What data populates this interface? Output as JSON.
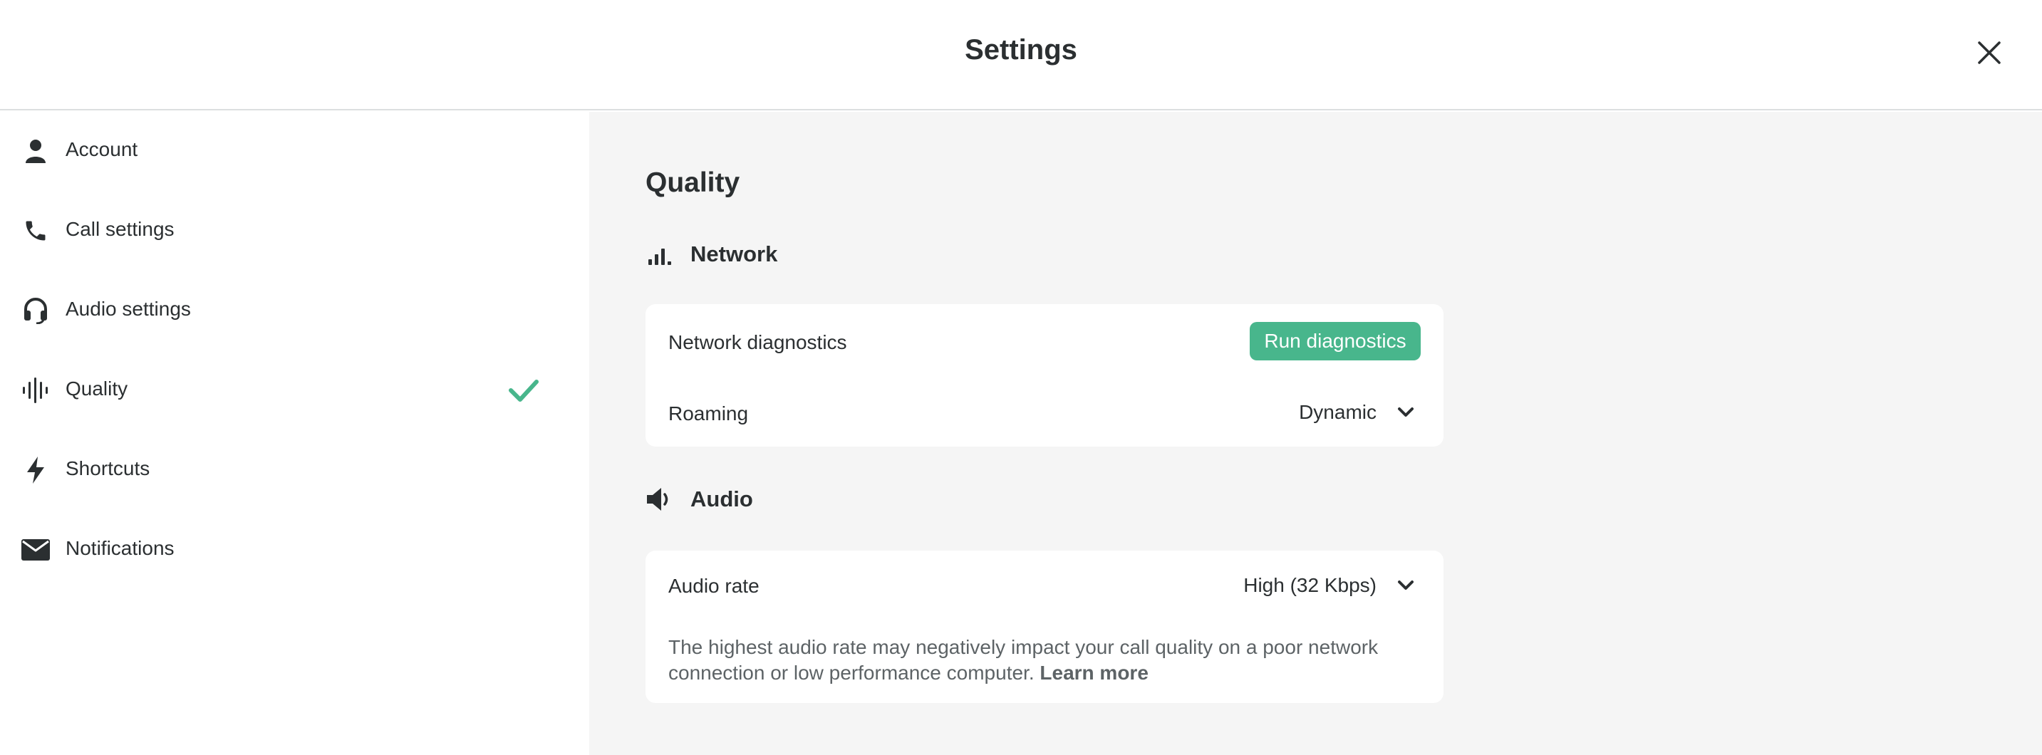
{
  "header": {
    "title": "Settings",
    "close_icon": "close-icon"
  },
  "sidebar": {
    "items": [
      {
        "label": "Account",
        "icon": "person-icon",
        "active": false
      },
      {
        "label": "Call settings",
        "icon": "phone-icon",
        "active": false
      },
      {
        "label": "Audio settings",
        "icon": "headset-icon",
        "active": false
      },
      {
        "label": "Quality",
        "icon": "waveform-icon",
        "active": true
      },
      {
        "label": "Shortcuts",
        "icon": "lightning-icon",
        "active": false
      },
      {
        "label": "Notifications",
        "icon": "envelope-icon",
        "active": false
      }
    ],
    "active_check_icon": "checkmark-icon"
  },
  "main": {
    "title": "Quality",
    "network": {
      "heading": "Network",
      "icon": "signal-bars-icon",
      "diagnostics_label": "Network diagnostics",
      "run_button": "Run diagnostics",
      "roaming_label": "Roaming",
      "roaming_value": "Dynamic"
    },
    "audio": {
      "heading": "Audio",
      "icon": "speaker-icon",
      "rate_label": "Audio rate",
      "rate_value": "High (32 Kbps)",
      "description": "The highest audio rate may negatively impact your call quality on a poor network connection or low performance computer.",
      "learn_more": "Learn more"
    }
  },
  "colors": {
    "accent": "#48b68c",
    "text": "#2b2f31",
    "muted_text": "#5d6366",
    "panel_background": "#f5f5f5",
    "card_background": "#ffffff"
  }
}
